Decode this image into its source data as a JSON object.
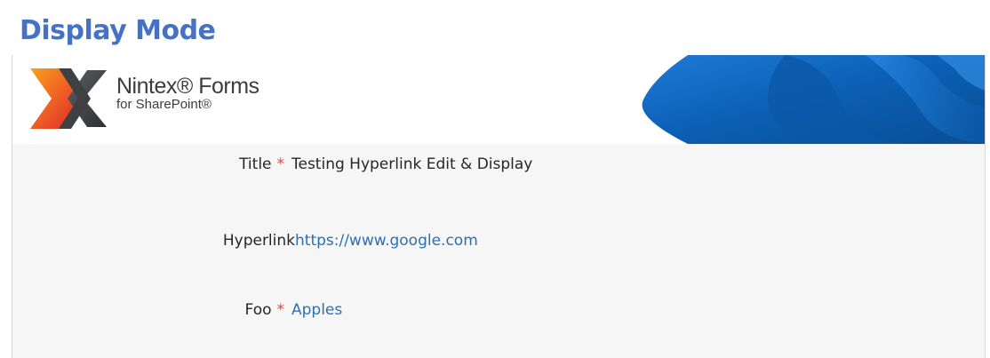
{
  "page": {
    "caption": "Display Mode"
  },
  "header": {
    "logo_icon": "nintex-x-logo-icon",
    "brand_name": "Nintex® Forms",
    "brand_sub": "for SharePoint®"
  },
  "form": {
    "fields": [
      {
        "label": "Title",
        "required": true,
        "value": "Testing Hyperlink Edit & Display",
        "kind": "text"
      },
      {
        "label": "Hyperlink",
        "required": false,
        "value": "https://www.google.com",
        "kind": "link"
      },
      {
        "label": "Foo",
        "required": true,
        "value": "Apples",
        "kind": "choice"
      }
    ],
    "required_marker": "*"
  },
  "colors": {
    "caption": "#4472c4",
    "required": "#e04848",
    "link": "#2c6fb3",
    "form_bg": "#f6f6f6",
    "banner_blue": "#0b5fb3"
  }
}
